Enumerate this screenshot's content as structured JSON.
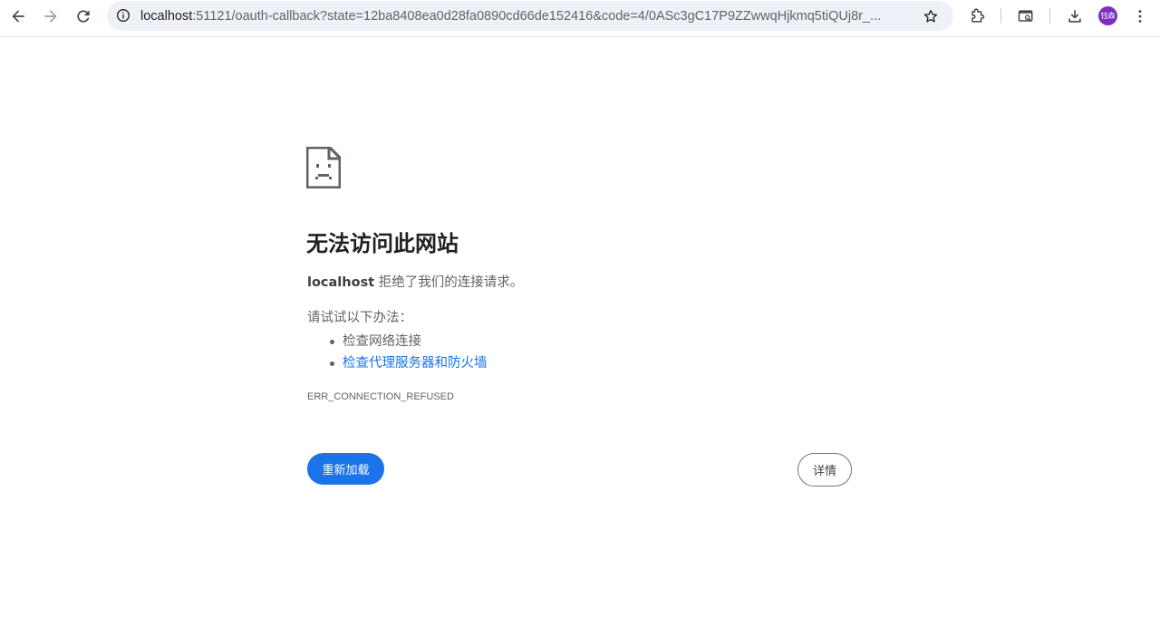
{
  "browser": {
    "url_host": "localhost",
    "url_rest": ":51121/oauth-callback?state=12ba8408ea0d28fa0890cd66de152416&code=4/0ASc3gC17P9ZZwwqHjkmq5tiQUj8r_...",
    "profile_avatar_text": "钰森",
    "icons": [
      "back-icon",
      "forward-icon",
      "reload-icon",
      "site-info-icon",
      "bookmark-star-icon",
      "extensions-icon",
      "tab-search-icon",
      "download-icon",
      "menu-icon"
    ],
    "accent_color": "#7b2fbf"
  },
  "error": {
    "title": "无法访问此网站",
    "host": "localhost",
    "description_suffix": " 拒绝了我们的连接请求。",
    "try_label": "请试试以下办法：",
    "suggestions": [
      {
        "text": "检查网络连接",
        "link": false
      },
      {
        "text": "检查代理服务器和防火墙",
        "link": true
      }
    ],
    "code": "ERR_CONNECTION_REFUSED",
    "reload_label": "重新加载",
    "details_label": "详情",
    "primary_color": "#1a73e8",
    "link_color": "#1a73e8"
  }
}
